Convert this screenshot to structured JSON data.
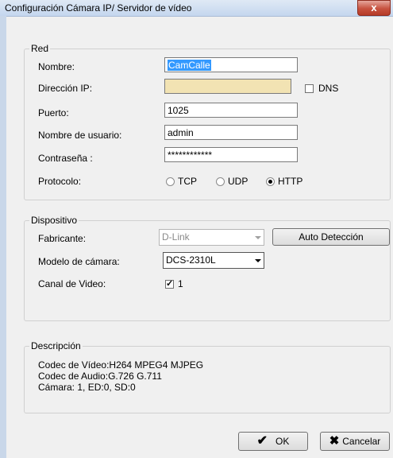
{
  "window": {
    "title": "Configuración Cámara IP/ Servidor de vídeo",
    "close_glyph": "x"
  },
  "red": {
    "legend": "Red",
    "nombre_label": "Nombre:",
    "nombre_value": "CamCalle",
    "ip_label": "Dirección IP:",
    "ip_value": "",
    "dns_label": "DNS",
    "puerto_label": "Puerto:",
    "puerto_value": "1025",
    "usuario_label": "Nombre de usuario:",
    "usuario_value": "admin",
    "password_label": "Contraseña :",
    "password_value": "************",
    "protocolo_label": "Protocolo:",
    "protocols": [
      "TCP",
      "UDP",
      "HTTP"
    ],
    "protocol_selected": "HTTP"
  },
  "dispositivo": {
    "legend": "Dispositivo",
    "fabricante_label": "Fabricante:",
    "fabricante_value": "D-Link",
    "auto_button": "Auto Detección",
    "modelo_label": "Modelo de cámara:",
    "modelo_value": "DCS-2310L",
    "canal_label": "Canal de Video:",
    "canal_value": "1"
  },
  "descripcion": {
    "legend": "Descripción",
    "line1": "Codec de Vídeo:H264 MPEG4 MJPEG",
    "line2": "Codec de Audio:G.726 G.711",
    "line3": "Cámara: 1, ED:0, SD:0"
  },
  "buttons": {
    "ok": "OK",
    "cancel": "Cancelar"
  },
  "colors": {
    "ip_field_bg": "#f2e3b3",
    "title_gradient_top": "#dfe9f5",
    "close_red": "#c7523f"
  }
}
